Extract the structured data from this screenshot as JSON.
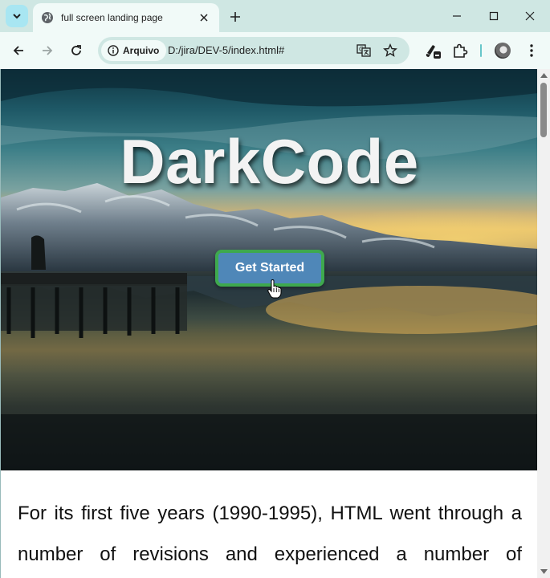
{
  "browser": {
    "tab": {
      "title": "full screen landing page"
    },
    "address": {
      "site_chip_label": "Arquivo",
      "url": "D:/jira/DEV-5/index.html#"
    },
    "icons": {
      "tab_search": "chevron-down-icon",
      "favicon": "globe-icon",
      "tab_close": "close-icon",
      "new_tab": "plus-icon",
      "back": "arrow-left-icon",
      "forward": "arrow-right-icon",
      "reload": "reload-icon",
      "info": "info-icon",
      "translate": "translate-icon",
      "bookmark": "star-icon",
      "extension_pinned": "paint-brush-icon",
      "extensions": "puzzle-icon",
      "menu": "kebab-menu-icon"
    },
    "colors": {
      "tabstrip": "#cfe7e3",
      "toolbar": "#f1faf8",
      "tab_search_button": "#a8e6f2"
    }
  },
  "page": {
    "hero": {
      "title": "DarkCode",
      "button_label": "Get Started",
      "button_color": "#4f87b8",
      "button_border_color": "#3ea94e"
    },
    "paragraph": "For its first five years (1990-1995), HTML went through a number of revisions and experienced a number of"
  }
}
